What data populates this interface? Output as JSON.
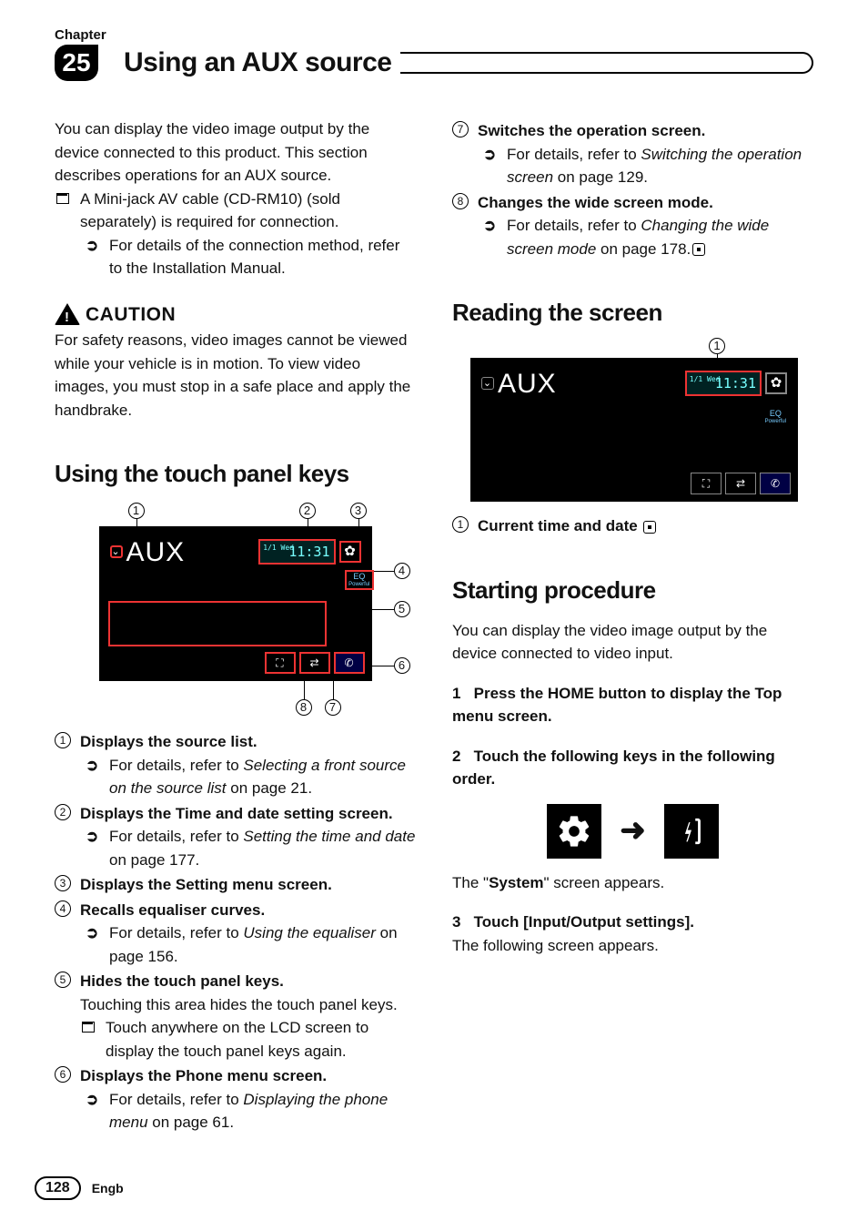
{
  "header": {
    "chapter_label": "Chapter",
    "chapter_number": "25",
    "title": "Using an AUX source"
  },
  "left": {
    "intro": "You can display the video image output by the device connected to this product. This section describes operations for an AUX source.",
    "cable_note": "A Mini-jack AV cable (CD-RM10) (sold separately) is required for connection.",
    "cable_detail": "For details of the connection method, refer to the Installation Manual.",
    "caution_label": "CAUTION",
    "caution_text": "For safety reasons, video images cannot be viewed while your vehicle is in motion. To view video images, you must stop in a safe place and apply the handbrake.",
    "section1_title": "Using the touch panel keys",
    "aux_text": "AUX",
    "time_dow": "1/1\nWed",
    "time_text": "11:31",
    "eq_text": "EQ",
    "eq_sub": "Powerful",
    "items": [
      {
        "n": "1",
        "title": "Displays the source list.",
        "detail_prefix": "For details, refer to ",
        "detail_italic": "Selecting a front source on the source list",
        "detail_suffix": " on page 21."
      },
      {
        "n": "2",
        "title": "Displays the Time and date setting screen.",
        "detail_prefix": "For details, refer to ",
        "detail_italic": "Setting the time and date",
        "detail_suffix": " on page 177."
      },
      {
        "n": "3",
        "title": "Displays the Setting menu screen."
      },
      {
        "n": "4",
        "title": "Recalls equaliser curves.",
        "detail_prefix": "For details, refer to ",
        "detail_italic": "Using the equaliser",
        "detail_suffix": " on page 156."
      },
      {
        "n": "5",
        "title": "Hides the touch panel keys.",
        "plain": "Touching this area hides the touch panel keys.",
        "square": "Touch anywhere on the LCD screen to display the touch panel keys again."
      },
      {
        "n": "6",
        "title": "Displays the Phone menu screen.",
        "detail_prefix": "For details, refer to ",
        "detail_italic": "Displaying the phone menu",
        "detail_suffix": " on page 61."
      }
    ]
  },
  "right": {
    "items_top": [
      {
        "n": "7",
        "title": "Switches the operation screen.",
        "detail_prefix": "For details, refer to ",
        "detail_italic": "Switching the operation screen",
        "detail_suffix": " on page 129."
      },
      {
        "n": "8",
        "title": "Changes the wide screen mode.",
        "detail_prefix": "For details, refer to ",
        "detail_italic": "Changing the wide screen mode",
        "detail_suffix": " on page 178.",
        "end": true
      }
    ],
    "section2_title": "Reading the screen",
    "reading_item_n": "1",
    "reading_item_title": "Current time and date",
    "section3_title": "Starting procedure",
    "start_intro": "You can display the video image output by the device connected to video input.",
    "step1_n": "1",
    "step1_text": "Press the HOME button to display the Top menu screen.",
    "step2_n": "2",
    "step2_text": "Touch the following keys in the following order.",
    "system_prefix": "The \"",
    "system_bold": "System",
    "system_suffix": "\" screen appears.",
    "step3_n": "3",
    "step3_text": "Touch [Input/Output settings].",
    "step3_after": "The following screen appears."
  },
  "footer": {
    "page": "128",
    "lang": "Engb"
  }
}
